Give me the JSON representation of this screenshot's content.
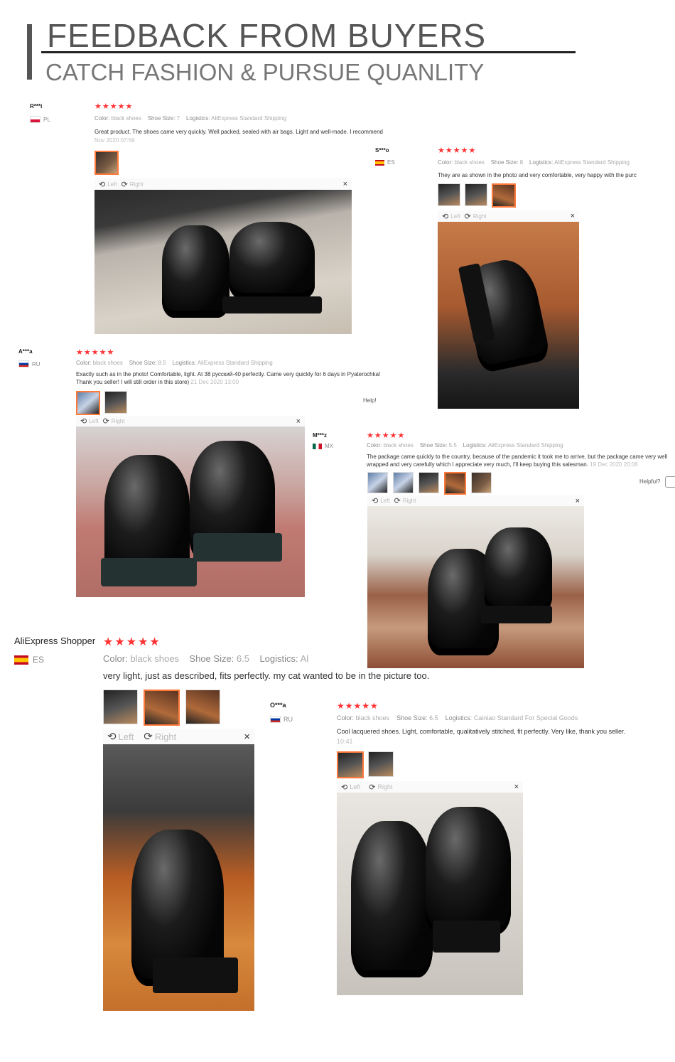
{
  "header": {
    "title": "FEEDBACK FROM BUYERS",
    "subtitle": "CATCH FASHION & PURSUE QUANLITY"
  },
  "viewer": {
    "left_label": "Left",
    "right_label": "Right",
    "close_glyph": "×"
  },
  "stars": "★★★★★",
  "reviews": [
    {
      "user": "R***i",
      "country": "PL",
      "color_label": "Color:",
      "color": "black shoes",
      "size_label": "Shoe Size:",
      "size": "7",
      "logistics_label": "Logistics:",
      "logistics": "AliExpress Standard Shipping",
      "text": "Great product. The shoes came very quickly. Well packed, sealed with air bags. Light and well-made. I recommend",
      "date": "Nov 2020 07:59"
    },
    {
      "user": "S***o",
      "country": "ES",
      "color_label": "Color:",
      "color": "black shoes",
      "size_label": "Shoe Size:",
      "size": "8",
      "logistics_label": "Logistics:",
      "logistics": "AliExpress Standard Shipping",
      "text": "They are as shown in the photo and very comfortable, very happy with the purc"
    },
    {
      "user": "A***a",
      "country": "RU",
      "color_label": "Color:",
      "color": "black shoes",
      "size_label": "Shoe Size:",
      "size": "8.5",
      "logistics_label": "Logistics:",
      "logistics": "AliExpress Standard Shipping",
      "text": "Exactly such as in the photo! Comfortable, light. At 38 русский-40 perfectly. Came very quickly for 6 days in Pyaterochka! Thank you seller! I will still order in this store)",
      "date": "21 Dec 2020 13:00",
      "helpful": "Help!"
    },
    {
      "user": "M***z",
      "country": "MX",
      "color_label": "Color:",
      "color": "black shoes",
      "size_label": "Shoe Size:",
      "size": "5.5",
      "logistics_label": "Logistics:",
      "logistics": "AliExpress Standard Shipping",
      "text": "The package came quickly to the country, because of the pandemic it took me to arrive, but the package came very well wrapped and very carefully which I appreciate very much, I'll keep buying this salesman.",
      "date": "19 Dec 2020 20:06",
      "helpful": "Helpful?"
    },
    {
      "user": "AliExpress Shopper",
      "country": "ES",
      "color_label": "Color:",
      "color": "black shoes",
      "size_label": "Shoe Size:",
      "size": "6.5",
      "logistics_label": "Logistics:",
      "logistics": "Ali",
      "text": "very light, just as described, fits perfectly. my cat wanted to be in the picture too."
    },
    {
      "user": "O***a",
      "country": "RU",
      "color_label": "Color:",
      "color": "black shoes",
      "size_label": "Shoe Size:",
      "size": "6.5",
      "logistics_label": "Logistics:",
      "logistics": "Cainiao Standard For Special Goods",
      "text": "Cool lacquered shoes. Light, comfortable, qualitatively stitched, fit perfectly. Very like, thank you seller.",
      "date": "10:41"
    }
  ]
}
